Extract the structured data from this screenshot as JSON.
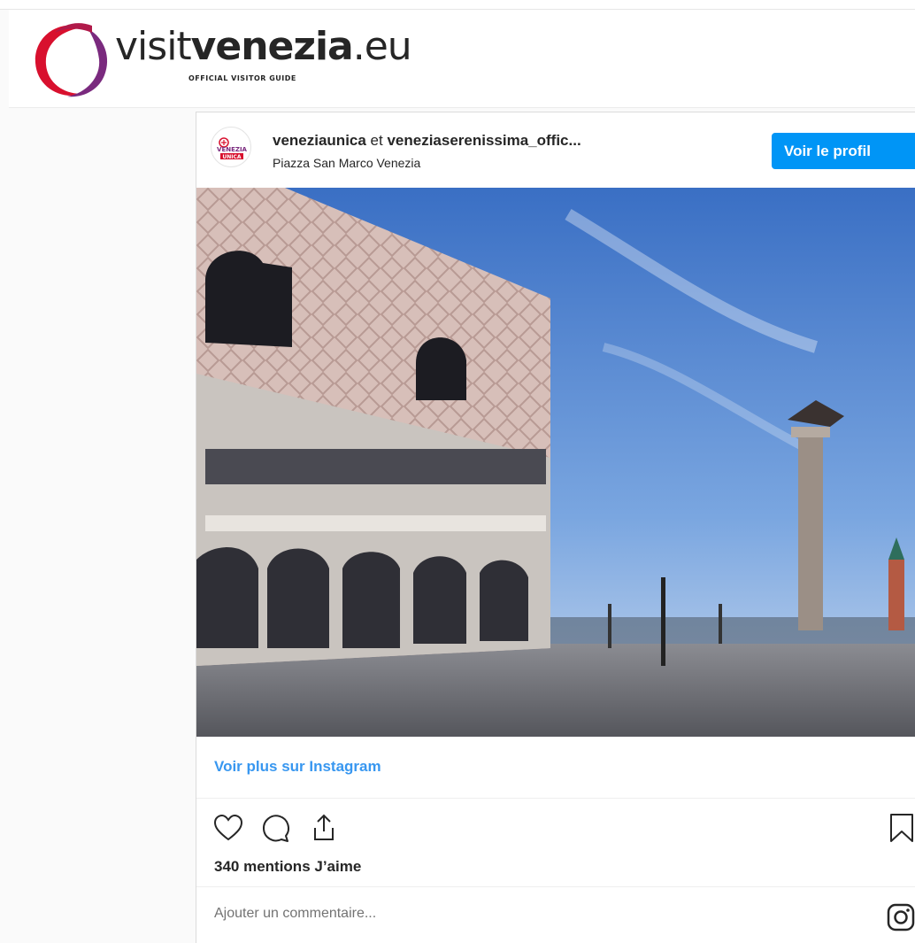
{
  "site": {
    "brand_light": "visit",
    "brand_bold": "venezia",
    "brand_suffix": ".eu",
    "tagline": "OFFICIAL VISITOR GUIDE"
  },
  "post": {
    "owner_1": "veneziaunica",
    "joiner": " et ",
    "owner_2": "veneziaserenissima_offic...",
    "location": "Piazza San Marco Venezia",
    "profile_button": "Voir le profil",
    "more_link": "Voir plus sur Instagram",
    "likes": "340 mentions J’aime",
    "comment_placeholder": "Ajouter un commentaire...",
    "avatar_text_1": "VENEZIA",
    "avatar_text_2": "UNICA"
  },
  "colors": {
    "accent": "#0095f6",
    "link": "#3897f0",
    "logo_red": "#d8102e",
    "logo_purple": "#7a2a7e"
  },
  "icons": [
    "heart-icon",
    "comment-icon",
    "share-icon",
    "bookmark-icon",
    "instagram-icon"
  ]
}
